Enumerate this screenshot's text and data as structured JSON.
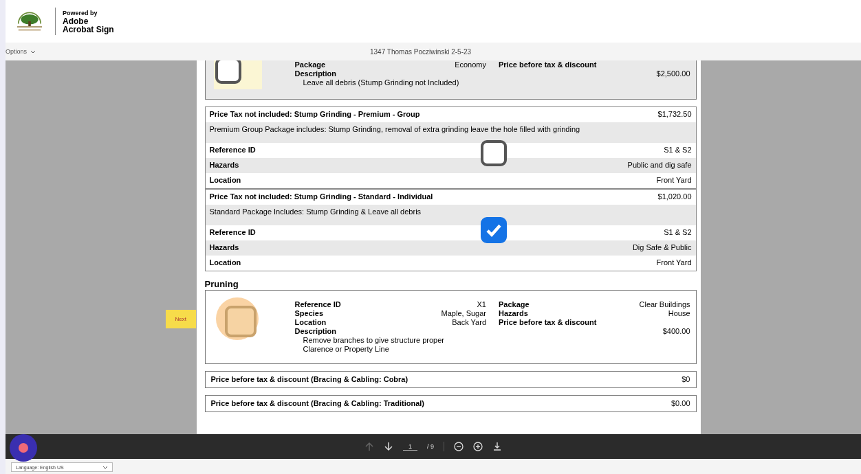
{
  "header": {
    "powered_by": "Powered by",
    "brand_lines": [
      "Adobe",
      "Acrobat Sign"
    ]
  },
  "toolbar": {
    "options": "Options",
    "title": "1347 Thomas Pocziwinski 2-5-23"
  },
  "first_card": {
    "checked": false,
    "left": [
      {
        "label": "Package",
        "value": "Economy"
      }
    ],
    "description_label": "Description",
    "description": [
      "Leave all debris (Stump Grinding not Included)"
    ],
    "right": [
      {
        "label": "Price before tax & discount"
      }
    ],
    "price": "$2,500.00"
  },
  "options": [
    {
      "title": "Price Tax not included: Stump Grinding - Premium - Group",
      "price": "$1,732.50",
      "description": "Premium Group Package includes: Stump Grinding, removal of extra grinding leave the hole filled with grinding",
      "checked": false,
      "rows": [
        {
          "label": "Reference ID",
          "value": "S1 & S2"
        },
        {
          "label": "Hazards",
          "value": "Public and dig safe"
        },
        {
          "label": "Location",
          "value": "Front Yard"
        }
      ]
    },
    {
      "title": "Price Tax not included: Stump Grinding - Standard - Individual",
      "price": "$1,020.00",
      "description": "Standard Package Includes: Stump Grinding & Leave all debris",
      "checked": true,
      "rows": [
        {
          "label": "Reference ID",
          "value": "S1 & S2"
        },
        {
          "label": "Hazards",
          "value": "Dig Safe & Public"
        },
        {
          "label": "Location",
          "value": "Front Yard"
        }
      ]
    }
  ],
  "pruning": {
    "heading": "Pruning",
    "next": "Next",
    "checked": false,
    "left": [
      {
        "label": "Reference ID",
        "value": "X1"
      },
      {
        "label": "Species",
        "value": "Maple, Sugar"
      },
      {
        "label": "Location",
        "value": "Back Yard"
      }
    ],
    "right": [
      {
        "label": "Package",
        "value": "Clear Buildings"
      },
      {
        "label": "Hazards",
        "value": "House"
      },
      {
        "label": "Price before tax & discount"
      }
    ],
    "description_label": "Description",
    "description": [
      "Remove branches to give structure proper",
      "Clarence or Property Line"
    ],
    "price": "$400.00"
  },
  "price_lines": [
    {
      "label": "Price before tax & discount (Bracing & Cabling: Cobra)",
      "value": "$0"
    },
    {
      "label": "Price before tax & discount (Bracing & Cabling: Traditional)",
      "value": "$0.00"
    }
  ],
  "pager": {
    "page": "1",
    "total": "/ 9",
    "prev_disabled": true
  },
  "language": {
    "value": "Language: English US"
  }
}
